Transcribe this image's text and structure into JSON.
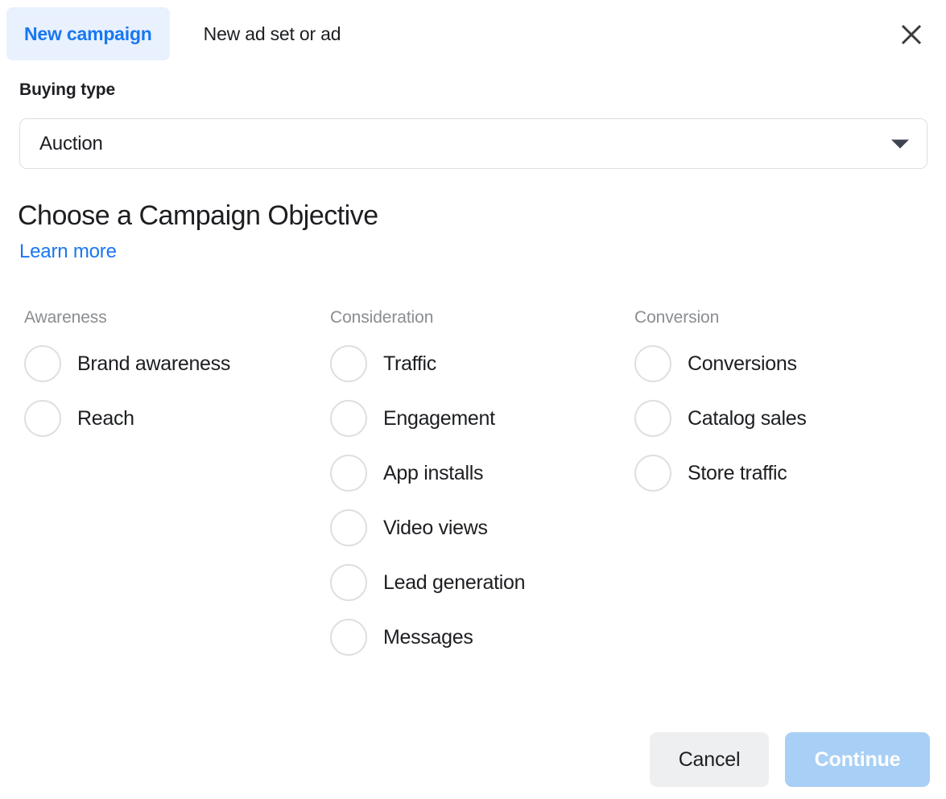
{
  "dialog": {
    "tabs": [
      {
        "label": "New campaign",
        "active": true
      },
      {
        "label": "New ad set or ad",
        "active": false
      }
    ],
    "close_icon": "close-icon"
  },
  "buying_type": {
    "label": "Buying type",
    "selected": "Auction",
    "caret_icon": "chevron-down-icon"
  },
  "objective": {
    "title": "Choose a Campaign Objective",
    "learn_more": "Learn more",
    "columns": [
      {
        "header": "Awareness",
        "options": [
          {
            "label": "Brand awareness",
            "selected": false
          },
          {
            "label": "Reach",
            "selected": false
          }
        ]
      },
      {
        "header": "Consideration",
        "options": [
          {
            "label": "Traffic",
            "selected": false
          },
          {
            "label": "Engagement",
            "selected": false
          },
          {
            "label": "App installs",
            "selected": false
          },
          {
            "label": "Video views",
            "selected": false
          },
          {
            "label": "Lead generation",
            "selected": false
          },
          {
            "label": "Messages",
            "selected": false
          }
        ]
      },
      {
        "header": "Conversion",
        "options": [
          {
            "label": "Conversions",
            "selected": false
          },
          {
            "label": "Catalog sales",
            "selected": false
          },
          {
            "label": "Store traffic",
            "selected": false
          }
        ]
      }
    ]
  },
  "footer": {
    "cancel_label": "Cancel",
    "continue_label": "Continue",
    "continue_disabled": true
  },
  "colors": {
    "accent_blue": "#1877f2",
    "tab_active_bg": "#e8f1fd",
    "continue_disabled_bg": "#a8cff5",
    "cancel_bg": "#eeeff0",
    "muted_text": "#8a8d91",
    "border": "#dcdee3",
    "radio_border": "#dedfe2"
  }
}
